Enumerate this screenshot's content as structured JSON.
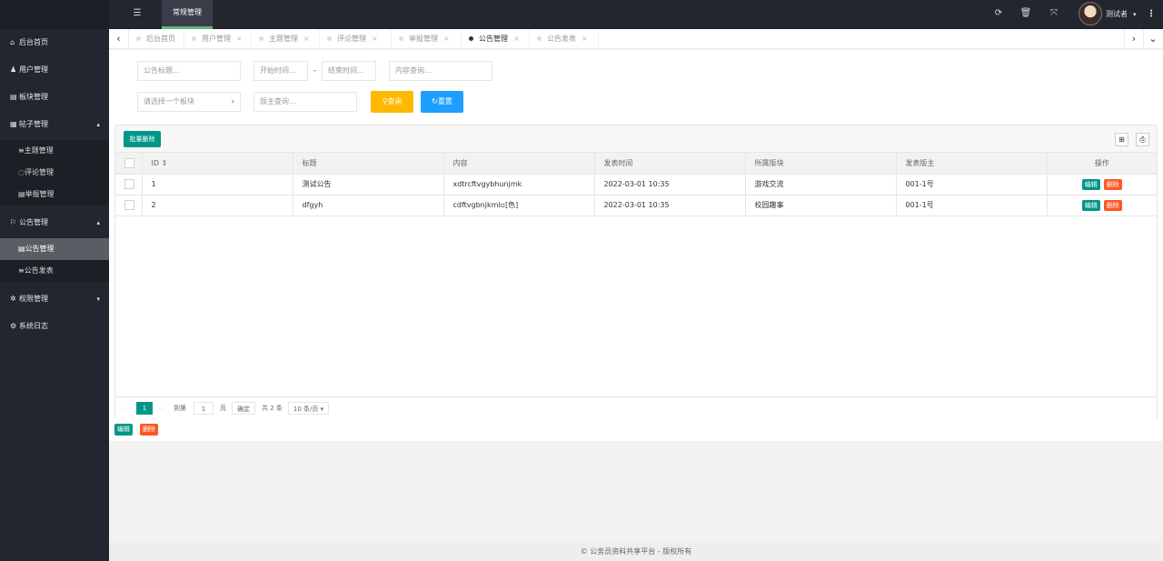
{
  "header": {
    "top_tab": "常规管理",
    "hamburger_icon": "☰",
    "refresh_icon": "⟳",
    "trash_icon": "🗑",
    "fullscreen_icon": "⤧",
    "user_name": "测试者",
    "user_caret": "▾",
    "more_icon": "⋮"
  },
  "sidebar": {
    "items": [
      {
        "icon": "⌂",
        "label": "后台首页"
      },
      {
        "icon": "♟",
        "label": "用户管理"
      },
      {
        "icon": "▤",
        "label": "板块管理"
      },
      {
        "icon": "▦",
        "label": "帖子管理",
        "caret": "▴"
      },
      {
        "icon": "⚐",
        "label": "公告管理",
        "caret": "▴"
      },
      {
        "icon": "✲",
        "label": "权限管理",
        "caret": "▾"
      },
      {
        "icon": "⚙",
        "label": "系统日志"
      }
    ],
    "subitems": [
      {
        "icon": "≡",
        "label": "主题管理"
      },
      {
        "icon": "◌",
        "label": "评论管理"
      },
      {
        "icon": "▤",
        "label": "举报管理"
      },
      {
        "icon": "▤",
        "label": "公告管理"
      },
      {
        "icon": "≡",
        "label": "公告发表"
      }
    ]
  },
  "tabs": {
    "left_arrow": "‹",
    "right_arrow": "›",
    "down_arrow": "⌄",
    "items": [
      {
        "label": "后台首页",
        "closable": false
      },
      {
        "label": "用户管理",
        "closable": true
      },
      {
        "label": "主题管理",
        "closable": true
      },
      {
        "label": "评论管理",
        "closable": true
      },
      {
        "label": "举报管理",
        "closable": true
      },
      {
        "label": "公告管理",
        "closable": true,
        "active": true
      },
      {
        "label": "公告发表",
        "closable": true
      }
    ],
    "close_glyph": "×"
  },
  "filters": {
    "title_placeholder": "公告标题...",
    "start_time_placeholder": "开始时间...",
    "dash": "-",
    "end_time_placeholder": "结束时间...",
    "content_placeholder": "内容查询...",
    "board_select": "请选择一个板块",
    "select_caret": "▾",
    "owner_placeholder": "版主查询...",
    "search_label": "⚲查询",
    "reset_label": "↻重置"
  },
  "table": {
    "batch_delete_label": "批量删除",
    "filter_icon": "⊞",
    "print_icon": "⎙",
    "headers": [
      "ID ⇕",
      "标题",
      "内容",
      "发表时间",
      "所属版块",
      "发表版主",
      "操作"
    ],
    "rows": [
      {
        "id": "1",
        "title": "测试公告",
        "content": "xdtrcftvgybhunjmk",
        "time": "2022-03-01 10:35",
        "board": "游戏交流",
        "owner": "001-1号"
      },
      {
        "id": "2",
        "title": "dfgyh",
        "content": "cdftvgbnjkml▫[色]",
        "time": "2022-03-01 10:35",
        "board": "校园趣事",
        "owner": "001-1号"
      }
    ],
    "edit_label": "编辑",
    "delete_label": "删除"
  },
  "pager": {
    "prev": "‹",
    "current_page": "1",
    "next": "›",
    "goto_label": "到第",
    "goto_value": "1",
    "page_suffix": "页",
    "confirm_label": "确定",
    "total_label": "共 2 条",
    "per_page": "10 条/页 ▾"
  },
  "bottom_actions": {
    "edit_label": "编辑",
    "delete_label": "删除"
  },
  "footer": {
    "text": "© 公务员资料共享平台 - 版权所有"
  },
  "colors": {
    "teal": "#009688",
    "orange": "#ff5722",
    "yellow": "#ffb800",
    "blue": "#1e9fff",
    "dark": "#23262e"
  }
}
